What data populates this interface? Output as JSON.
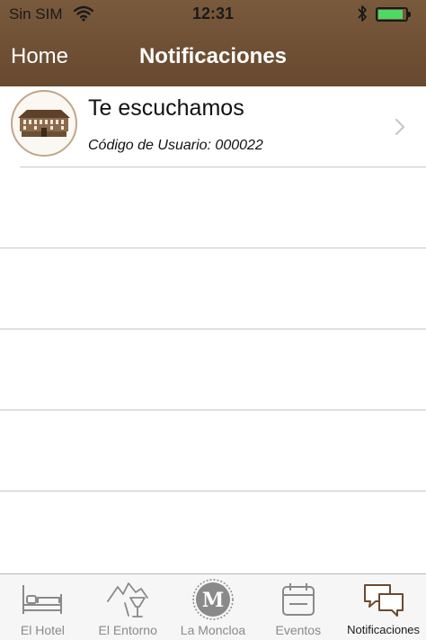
{
  "status_bar": {
    "carrier": "Sin SIM",
    "time": "12:31",
    "battery_level": 0.9,
    "icons": [
      "wifi-icon",
      "bluetooth-icon",
      "battery-icon"
    ]
  },
  "nav": {
    "back_label": "Home",
    "title": "Notificaciones"
  },
  "notifications": [
    {
      "title": "Te escuchamos",
      "subtitle": "Código de Usuario: 000022",
      "thumbnail": "hotel-building-thumbnail"
    }
  ],
  "empty_rows": 4,
  "tabs": [
    {
      "label": "El Hotel",
      "icon": "bed-icon",
      "active": false
    },
    {
      "label": "El Entorno",
      "icon": "mountains-drink-icon",
      "active": false
    },
    {
      "label": "La Moncloa",
      "icon": "moncloa-m-icon",
      "active": false
    },
    {
      "label": "Eventos",
      "icon": "calendar-icon",
      "active": false
    },
    {
      "label": "Notificaciones",
      "icon": "chat-bubbles-icon",
      "active": true
    }
  ],
  "colors": {
    "header_brown": "#6f5034",
    "accent_brown": "#6b4a2e",
    "inactive_tab": "#8a8a8a",
    "battery_green": "#4cd964"
  }
}
